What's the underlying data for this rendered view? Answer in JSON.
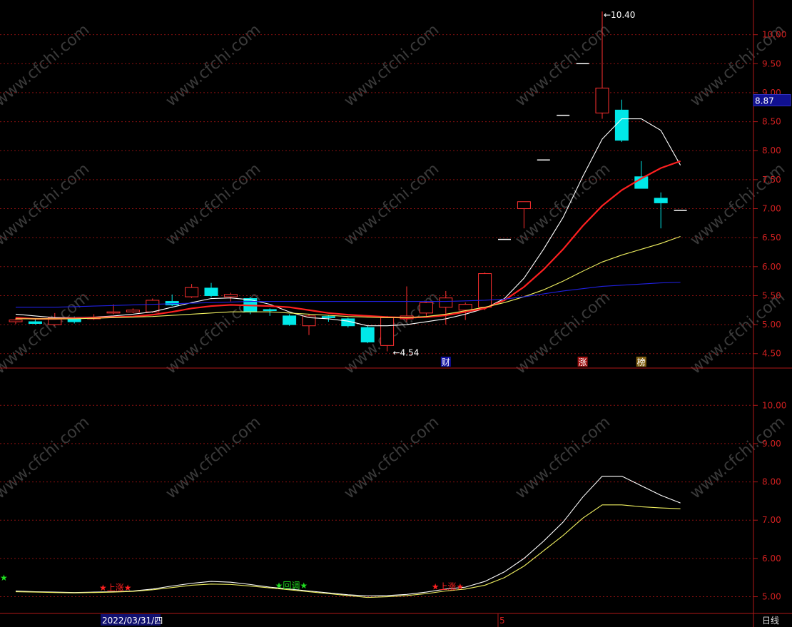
{
  "chart_data": [
    {
      "type": "candlestick",
      "panel": "main",
      "ylim": [
        4.3,
        10.5
      ],
      "y_ticks": [
        "4.50",
        "5.00",
        "5.50",
        "6.00",
        "6.50",
        "7.00",
        "7.50",
        "8.00",
        "8.50",
        "9.00",
        "9.50",
        "10.00"
      ],
      "y_tick_values": [
        4.5,
        5.0,
        5.5,
        6.0,
        6.5,
        7.0,
        7.5,
        8.0,
        8.5,
        9.0,
        9.5,
        10.0
      ],
      "current_price_label": "8.87",
      "current_price": 8.87,
      "high_annotation": "10.40",
      "high_value": 10.4,
      "low_annotation": "4.54",
      "low_value": 4.54,
      "candles": [
        {
          "o": 5.05,
          "c": 5.08,
          "h": 5.12,
          "l": 5.01
        },
        {
          "o": 5.05,
          "c": 5.02,
          "h": 5.1,
          "l": 5.0
        },
        {
          "o": 5.0,
          "c": 5.12,
          "h": 5.2,
          "l": 4.98
        },
        {
          "o": 5.1,
          "c": 5.05,
          "h": 5.14,
          "l": 5.02
        },
        {
          "o": 5.1,
          "c": 5.12,
          "h": 5.18,
          "l": 5.08
        },
        {
          "o": 5.2,
          "c": 5.22,
          "h": 5.35,
          "l": 5.18
        },
        {
          "o": 5.22,
          "c": 5.25,
          "h": 5.28,
          "l": 5.2
        },
        {
          "o": 5.22,
          "c": 5.42,
          "h": 5.45,
          "l": 5.2
        },
        {
          "o": 5.4,
          "c": 5.34,
          "h": 5.52,
          "l": 5.32
        },
        {
          "o": 5.48,
          "c": 5.64,
          "h": 5.7,
          "l": 5.46
        },
        {
          "o": 5.63,
          "c": 5.5,
          "h": 5.72,
          "l": 5.47
        },
        {
          "o": 5.48,
          "c": 5.52,
          "h": 5.55,
          "l": 5.4
        },
        {
          "o": 5.45,
          "c": 5.22,
          "h": 5.48,
          "l": 5.18
        },
        {
          "o": 5.26,
          "c": 5.24,
          "h": 5.28,
          "l": 5.15
        },
        {
          "o": 5.15,
          "c": 5.0,
          "h": 5.18,
          "l": 4.98
        },
        {
          "o": 4.98,
          "c": 5.15,
          "h": 5.18,
          "l": 4.82
        },
        {
          "o": 5.14,
          "c": 5.12,
          "h": 5.16,
          "l": 5.05
        },
        {
          "o": 5.1,
          "c": 4.98,
          "h": 5.12,
          "l": 4.95
        },
        {
          "o": 4.95,
          "c": 4.7,
          "h": 4.98,
          "l": 4.68
        },
        {
          "o": 4.64,
          "c": 5.12,
          "h": 5.15,
          "l": 4.54
        },
        {
          "o": 5.1,
          "c": 5.15,
          "h": 5.66,
          "l": 5.05
        },
        {
          "o": 5.2,
          "c": 5.38,
          "h": 5.4,
          "l": 5.15
        },
        {
          "o": 5.3,
          "c": 5.46,
          "h": 5.58,
          "l": 5.0
        },
        {
          "o": 5.25,
          "c": 5.35,
          "h": 5.38,
          "l": 5.08
        },
        {
          "o": 5.3,
          "c": 5.88,
          "h": 5.9,
          "l": 5.25
        },
        {
          "o": 6.47,
          "c": 6.47,
          "h": 6.47,
          "l": 6.47
        },
        {
          "o": 7.0,
          "c": 7.12,
          "h": 7.12,
          "l": 6.66
        },
        {
          "o": 7.84,
          "c": 7.84,
          "h": 7.84,
          "l": 7.84
        },
        {
          "o": 8.61,
          "c": 8.61,
          "h": 8.61,
          "l": 8.61
        },
        {
          "o": 9.5,
          "c": 9.5,
          "h": 9.5,
          "l": 9.5
        },
        {
          "o": 8.65,
          "c": 9.08,
          "h": 10.4,
          "l": 8.55
        },
        {
          "o": 8.7,
          "c": 8.18,
          "h": 8.88,
          "l": 8.15
        },
        {
          "o": 7.55,
          "c": 7.35,
          "h": 7.82,
          "l": 7.35
        },
        {
          "o": 7.18,
          "c": 7.1,
          "h": 7.28,
          "l": 6.66
        },
        {
          "o": 6.97,
          "c": 6.97,
          "h": 6.97,
          "l": 6.97
        }
      ],
      "series": [
        {
          "color": "#ffffff",
          "values": [
            5.18,
            5.15,
            5.12,
            5.12,
            5.13,
            5.15,
            5.18,
            5.22,
            5.3,
            5.38,
            5.45,
            5.46,
            5.43,
            5.35,
            5.22,
            5.12,
            5.1,
            5.06,
            4.98,
            4.98,
            5.0,
            5.05,
            5.1,
            5.18,
            5.28,
            5.45,
            5.8,
            6.3,
            6.85,
            7.55,
            8.2,
            8.55,
            8.55,
            8.35,
            7.75
          ]
        },
        {
          "color": "#ff2020",
          "values": [
            5.12,
            5.1,
            5.1,
            5.11,
            5.12,
            5.13,
            5.14,
            5.17,
            5.22,
            5.28,
            5.32,
            5.34,
            5.33,
            5.32,
            5.3,
            5.25,
            5.2,
            5.17,
            5.15,
            5.13,
            5.12,
            5.13,
            5.16,
            5.22,
            5.28,
            5.42,
            5.65,
            5.95,
            6.3,
            6.7,
            7.05,
            7.32,
            7.52,
            7.7,
            7.82
          ]
        },
        {
          "color": "#f0f060",
          "values": [
            5.1,
            5.1,
            5.1,
            5.1,
            5.11,
            5.12,
            5.13,
            5.14,
            5.16,
            5.18,
            5.2,
            5.22,
            5.22,
            5.22,
            5.2,
            5.18,
            5.16,
            5.14,
            5.13,
            5.12,
            5.12,
            5.14,
            5.18,
            5.24,
            5.3,
            5.38,
            5.48,
            5.6,
            5.75,
            5.92,
            6.08,
            6.2,
            6.3,
            6.4,
            6.52
          ]
        },
        {
          "color": "#2020e0",
          "values": [
            5.3,
            5.3,
            5.3,
            5.31,
            5.32,
            5.33,
            5.34,
            5.35,
            5.36,
            5.37,
            5.38,
            5.39,
            5.4,
            5.4,
            5.4,
            5.4,
            5.4,
            5.4,
            5.4,
            5.4,
            5.4,
            5.4,
            5.4,
            5.41,
            5.42,
            5.44,
            5.48,
            5.53,
            5.58,
            5.62,
            5.66,
            5.68,
            5.7,
            5.72,
            5.73
          ]
        }
      ],
      "markers": [
        {
          "label": "财",
          "index": 22,
          "color": "#ffffff",
          "bg": "#1010a0"
        },
        {
          "label": "涨",
          "index": 29,
          "color": "#ffffff",
          "bg": "#a01010"
        },
        {
          "label": "榜",
          "index": 32,
          "color": "#ffffff",
          "bg": "#806010"
        }
      ]
    },
    {
      "type": "line",
      "panel": "indicator",
      "ylim": [
        4.6,
        10.9
      ],
      "y_ticks": [
        "5.00",
        "6.00",
        "7.00",
        "8.00",
        "9.00",
        "10.00"
      ],
      "y_tick_values": [
        5.0,
        6.0,
        7.0,
        8.0,
        9.0,
        10.0
      ],
      "series": [
        {
          "color": "#ffffff",
          "values": [
            5.15,
            5.13,
            5.12,
            5.11,
            5.12,
            5.13,
            5.15,
            5.2,
            5.28,
            5.35,
            5.4,
            5.38,
            5.32,
            5.25,
            5.2,
            5.15,
            5.1,
            5.05,
            5.02,
            5.03,
            5.06,
            5.12,
            5.2,
            5.25,
            5.4,
            5.65,
            6.0,
            6.45,
            6.95,
            7.6,
            8.15,
            8.15,
            7.9,
            7.65,
            7.45
          ]
        },
        {
          "color": "#f0f060",
          "values": [
            5.13,
            5.12,
            5.11,
            5.1,
            5.11,
            5.12,
            5.14,
            5.18,
            5.24,
            5.3,
            5.33,
            5.32,
            5.28,
            5.23,
            5.18,
            5.13,
            5.08,
            5.03,
            4.98,
            5.0,
            5.03,
            5.08,
            5.15,
            5.2,
            5.3,
            5.5,
            5.8,
            6.2,
            6.6,
            7.05,
            7.4,
            7.4,
            7.35,
            7.32,
            7.3
          ]
        }
      ],
      "annotations": [
        {
          "label": "★",
          "index": 0,
          "color": "#20e020"
        },
        {
          "label": "★上涨★",
          "index": 5,
          "color": "#ff2020"
        },
        {
          "label": "★回调★",
          "index": 14,
          "color": "#20e020"
        },
        {
          "label": "★上涨★",
          "index": 22,
          "color": "#ff2020"
        }
      ]
    }
  ],
  "footer": {
    "date_label": "2022/03/31/四",
    "month_label": "5",
    "period_label": "日线"
  },
  "watermark": "www.cfchi.com",
  "colors": {
    "up": "#ff3030",
    "down": "#00e8e8",
    "grid": "#8a1010",
    "frame": "#b01818",
    "axis_text": "#d02020"
  }
}
